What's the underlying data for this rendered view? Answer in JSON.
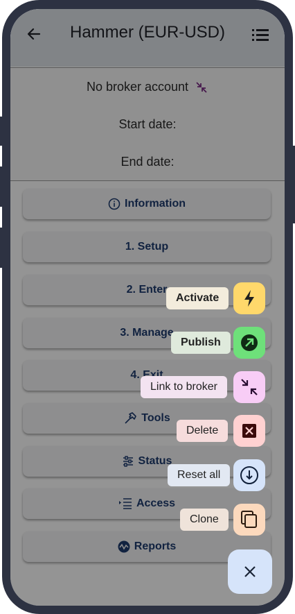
{
  "header": {
    "title": "Hammer (EUR-USD)",
    "back_icon": "arrow-left-icon",
    "menu_icon": "list-menu-icon"
  },
  "info_rows": {
    "broker": "No broker account",
    "start_date": "Start date:",
    "end_date": "End date:"
  },
  "sections": [
    {
      "label": "Information",
      "icon": "info-icon"
    },
    {
      "label": "1. Setup",
      "icon": ""
    },
    {
      "label": "2. Enter",
      "icon": ""
    },
    {
      "label": "3. Manage",
      "icon": ""
    },
    {
      "label": "4. Exit",
      "icon": ""
    },
    {
      "label": "Tools",
      "icon": "hammer-icon"
    },
    {
      "label": "Status",
      "icon": "sliders-icon"
    },
    {
      "label": "Access",
      "icon": "indent-list-icon"
    },
    {
      "label": "Reports",
      "icon": "chart-wave-icon"
    }
  ],
  "speed_dial": [
    {
      "label": "Activate",
      "icon": "lightning-icon",
      "color": "#ffd86b",
      "label_bg": "#f3ecdc"
    },
    {
      "label": "Publish",
      "icon": "arrow-up-right-circle-icon",
      "color": "#6ee07a",
      "label_bg": "#dfeadc"
    },
    {
      "label": "Link to broker",
      "icon": "collapse-arrows-icon",
      "color": "#f8cdf6",
      "label_bg": "#f3e3f1"
    },
    {
      "label": "Delete",
      "icon": "close-box-icon",
      "color": "#ffd1d1",
      "label_bg": "#f6dcdc"
    },
    {
      "label": "Reset all",
      "icon": "reset-circle-icon",
      "color": "#d6e4fa",
      "label_bg": "#e2e8f2"
    },
    {
      "label": "Clone",
      "icon": "copy-icon",
      "color": "#fcd9bd",
      "label_bg": "#efe3da"
    }
  ],
  "fab": {
    "icon": "close-icon",
    "color": "#d6e4fa"
  },
  "colors": {
    "section_text": "#1e3c6e",
    "scrim": "rgba(0,0,0,0.42)",
    "frame": "#2d3242"
  }
}
